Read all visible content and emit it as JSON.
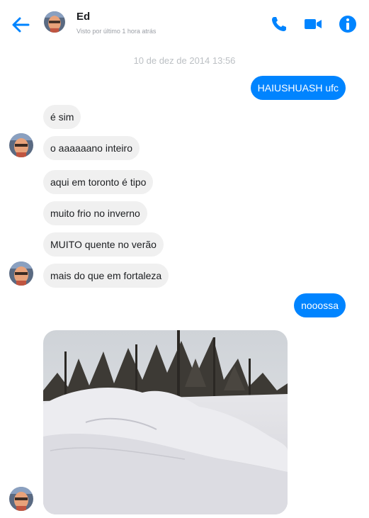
{
  "header": {
    "contact_name": "Ed",
    "last_seen": "Visto por último 1 hora atrás",
    "icons": {
      "back": "arrow-left-icon",
      "call": "phone-icon",
      "video": "video-camera-icon",
      "info": "info-icon"
    },
    "accent_color": "#0084ff"
  },
  "conversation": {
    "timestamp": "10 de dez de 2014 13:56",
    "messages": [
      {
        "from": "me",
        "text": "HAIUSHUASH ufc"
      },
      {
        "from": "contact",
        "text": "é sim"
      },
      {
        "from": "contact",
        "text": "o aaaaaano inteiro"
      },
      {
        "from": "contact",
        "text": "aqui em toronto é tipo"
      },
      {
        "from": "contact",
        "text": "muito frio no inverno"
      },
      {
        "from": "contact",
        "text": "MUITO quente no verão"
      },
      {
        "from": "contact",
        "text": "mais do que em fortaleza"
      },
      {
        "from": "me",
        "text": "nooossa"
      },
      {
        "from": "contact",
        "type": "photo",
        "subject": "snowy park with pine trees"
      }
    ]
  },
  "colors": {
    "outgoing_bubble": "#0084ff",
    "incoming_bubble": "#f0f0f0"
  }
}
